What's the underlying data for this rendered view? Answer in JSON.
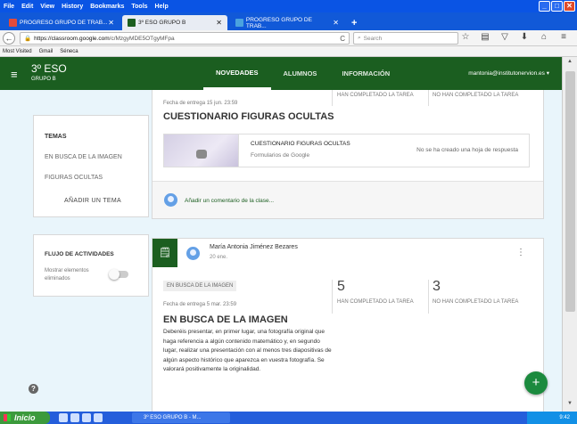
{
  "menubar": {
    "items": [
      "File",
      "Edit",
      "View",
      "History",
      "Bookmarks",
      "Tools",
      "Help"
    ]
  },
  "tabs": [
    {
      "label": "PROGRESO GRUPO DE TRAB..."
    },
    {
      "label": "3º ESO GRUPO B"
    },
    {
      "label": "PROGRESO GRUPO DE TRAB..."
    }
  ],
  "addressbar": {
    "host": "https://classroom.google.com",
    "path": "/c/MzgyMDE5OTgyMFpa",
    "search_placeholder": "Search"
  },
  "bookmarks": [
    "Most Visited",
    "Gmail",
    "Séneca"
  ],
  "header": {
    "class_name": "3º ESO",
    "class_section": "GRUPO B",
    "nav": [
      "NOVEDADES",
      "ALUMNOS",
      "INFORMACIÓN"
    ],
    "user": "mantonia@institutonervion.es"
  },
  "topics": {
    "title": "TEMAS",
    "items": [
      "EN BUSCA DE LA IMAGEN",
      "FIGURAS OCULTAS"
    ],
    "add_label": "AÑADIR UN TEMA"
  },
  "activity": {
    "title": "FLUJO DE ACTIVIDADES",
    "toggle_label": "Mostrar elementos eliminados"
  },
  "post1": {
    "done_label": "HAN COMPLETADO LA TAREA",
    "notdone_label": "NO HAN COMPLETADO LA TAREA",
    "due": "Fecha de entrega 15 jun. 23:59",
    "title": "CUESTIONARIO FIGURAS OCULTAS",
    "attachment_title": "CUESTIONARIO FIGURAS OCULTAS",
    "attachment_source": "Formularios de Google",
    "attachment_status": "No se ha creado una hoja de respuesta",
    "comment_placeholder": "Añadir un comentario de la clase..."
  },
  "post2": {
    "author": "María Antonia Jiménez Bezares",
    "date": "20 ene.",
    "topic": "EN BUSCA DE LA IMAGEN",
    "done_count": "5",
    "done_label": "HAN COMPLETADO LA TAREA",
    "notdone_count": "3",
    "notdone_label": "NO HAN COMPLETADO LA TAREA",
    "due": "Fecha de entrega 5 mar. 23:59",
    "title": "EN BUSCA DE LA IMAGEN",
    "description": "Deberéis presentar, en primer lugar, una fotografía original que haga referencia a algún contenido matemático y, en segundo lugar, realizar una presentación con al menos tres diapositivas de algún aspecto histórico que aparezca en vuestra fotografía. Se valorará positivamente la originalidad."
  },
  "taskbar": {
    "start": "Inicio",
    "item": "3º ESO GRUPO B - M...",
    "clock": "9:42"
  },
  "colors": {
    "header_green": "#1b5e20",
    "page_bg": "#e9f5fb",
    "fab_green": "#1b8a3e"
  }
}
